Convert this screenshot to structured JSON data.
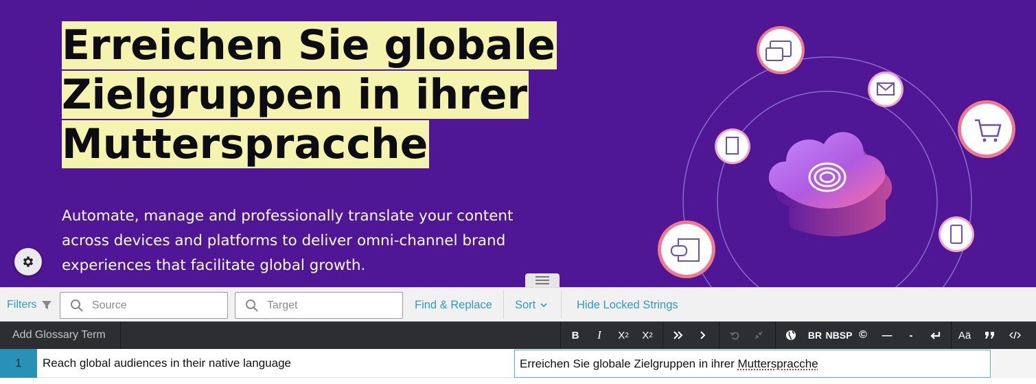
{
  "hero": {
    "title": "Erreichen Sie globale Zielgruppen in ihrer Mutterspracche",
    "subtitle": "Automate, manage and professionally translate your content across devices and platforms to deliver omni-channel brand experiences that facilitate global growth.",
    "background_color": "#4f1696",
    "highlight_color": "#f4f4ae"
  },
  "filterbar": {
    "filters_label": "Filters",
    "source_placeholder": "Source",
    "target_placeholder": "Target",
    "find_replace_label": "Find & Replace",
    "sort_label": "Sort",
    "hide_locked_label": "Hide Locked Strings"
  },
  "toolbar": {
    "glossary_label": "Add Glossary Term",
    "bold": "B",
    "italic": "I",
    "superscript_base": "X",
    "superscript_mark": "2",
    "subscript_base": "X",
    "subscript_mark": "2",
    "br": "BR",
    "nbsp": "NBSP",
    "copyright": "©",
    "em_dash": "—",
    "hyphen": "-",
    "case": "Aä"
  },
  "row": {
    "number": "1",
    "source": "Reach global audiences in their native language",
    "target_prefix": "Erreichen Sie globale Zielgruppen in ihrer ",
    "target_misspelled": "Mutterspracche"
  },
  "colors": {
    "accent": "#2a9dc4",
    "toolbar_bg": "#2c2e31",
    "row_number_bg": "#2891b5"
  }
}
